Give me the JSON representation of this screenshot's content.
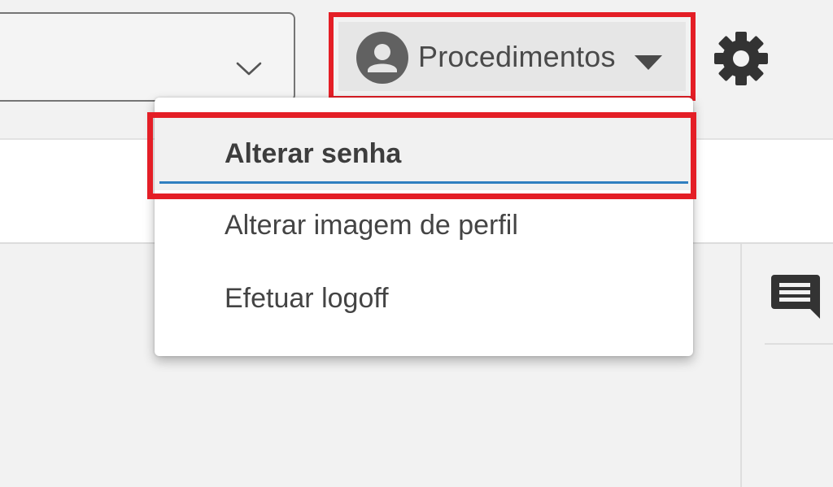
{
  "header": {
    "profile_menu_label": "Procedimentos",
    "icons": {
      "select": "chevron-down-icon",
      "avatar": "account-circle-icon",
      "caret": "caret-down-icon",
      "settings": "gear-icon"
    }
  },
  "dropdown": {
    "items": [
      {
        "label": "Alterar senha",
        "state": "highlighted"
      },
      {
        "label": "Alterar imagem de perfil"
      },
      {
        "label": "Efetuar logoff"
      }
    ]
  },
  "side_panel": {
    "icons": {
      "chat": "chat-icon"
    }
  },
  "colors": {
    "annotation_highlight": "#e41e26",
    "item_underline": "#2f7fc0",
    "text": "#444444",
    "background": "#f2f2f2"
  }
}
